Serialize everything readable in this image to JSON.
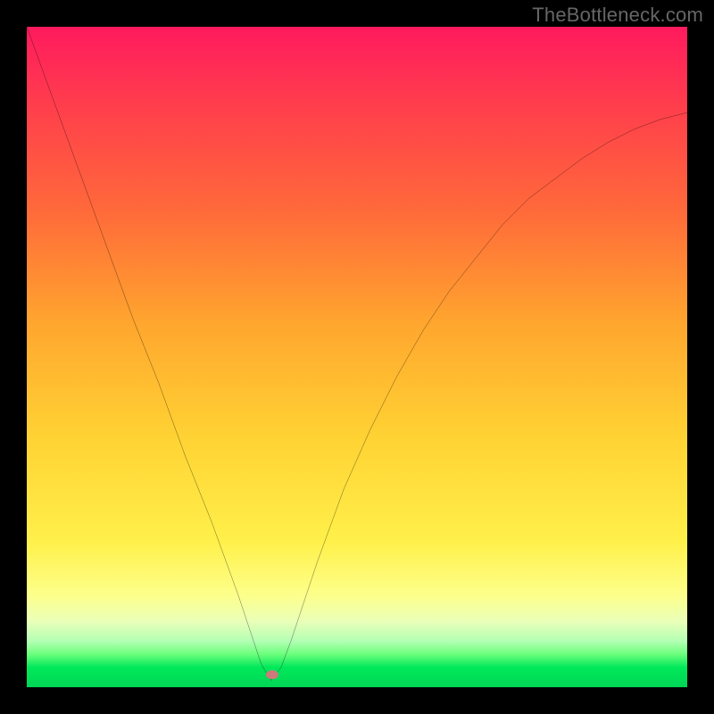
{
  "watermark": "TheBottleneck.com",
  "marker": {
    "color": "#cf7a7a",
    "x_pct": 37.2,
    "y_pct": 98.1
  },
  "chart_data": {
    "type": "line",
    "title": "",
    "xlabel": "",
    "ylabel": "",
    "xlim": [
      0,
      100
    ],
    "ylim": [
      0,
      100
    ],
    "grid": false,
    "legend": false,
    "background": "rainbow-gradient (red top → green bottom)",
    "note": "Bottleneck-style V curve; minimum near x≈37; values read from axes are approximate percentages",
    "series": [
      {
        "name": "curve",
        "color": "#000000",
        "x": [
          0,
          4,
          8,
          12,
          16,
          20,
          24,
          28,
          32,
          34,
          35.5,
          37,
          38.5,
          40,
          44,
          48,
          52,
          56,
          60,
          64,
          68,
          72,
          76,
          80,
          84,
          88,
          92,
          96,
          100
        ],
        "y": [
          100,
          89,
          78,
          67,
          56,
          46,
          35,
          25,
          14,
          8,
          3.5,
          1,
          3,
          7,
          19,
          30,
          39,
          47,
          54,
          60,
          65,
          70,
          74,
          77,
          80,
          82.5,
          84.5,
          86,
          87
        ]
      }
    ],
    "markers": [
      {
        "name": "minimum",
        "x": 37.2,
        "y": 1.9,
        "color": "#cf7a7a"
      }
    ]
  }
}
